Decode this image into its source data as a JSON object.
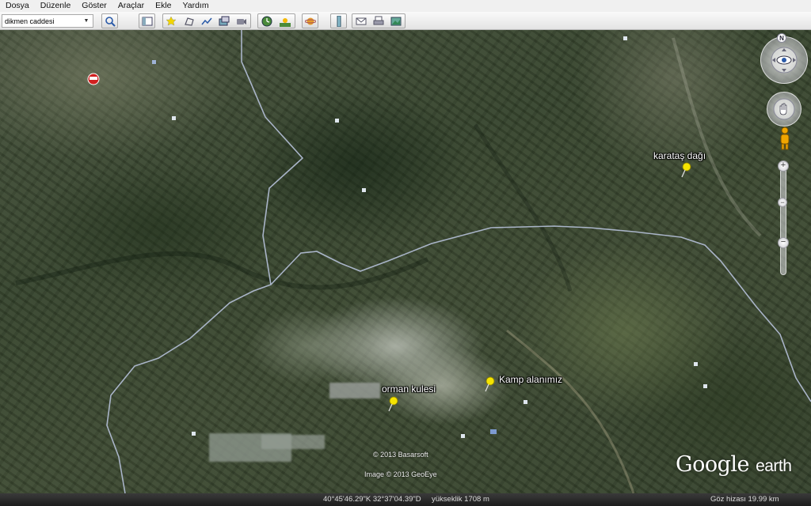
{
  "menu": [
    "Dosya",
    "Düzenle",
    "Göster",
    "Araçlar",
    "Ekle",
    "Yardım"
  ],
  "search": {
    "value": "dikmen caddesi"
  },
  "toolbar_icons": [
    "search-icon",
    "sidebar-icon",
    "add-placemark-icon",
    "add-polygon-icon",
    "add-path-icon",
    "add-image-overlay-icon",
    "record-tour-icon",
    "historical-imagery-icon",
    "sunlight-icon",
    "switch-to-sky-icon",
    "ruler-icon",
    "email-icon",
    "print-icon",
    "save-image-icon"
  ],
  "placemarks": [
    {
      "label": "karataş dağı"
    },
    {
      "label": "Kamp alanımız"
    },
    {
      "label": "orman kulesi"
    }
  ],
  "copyright": {
    "line1": "© 2013 Basarsoft",
    "line2": "Image © 2013 GeoEye"
  },
  "logo": {
    "brand": "Google",
    "product": "earth"
  },
  "status": {
    "coords": "40°45'46.29\"K  32°37'04.39\"D",
    "elevation": "yükseklik  1708 m",
    "eye_alt": "Göz hizası    19.99 km"
  },
  "compass": {
    "north": "N"
  },
  "colors": {
    "placemark_pin": "#f5e400",
    "border_line": "#a9b4c8",
    "menu_bg": "#f0f0f0"
  }
}
